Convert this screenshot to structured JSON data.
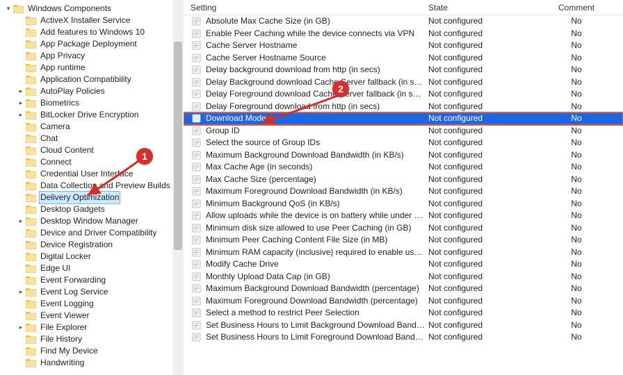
{
  "tree": {
    "root_label": "Windows Components",
    "items": [
      {
        "label": "ActiveX Installer Service"
      },
      {
        "label": "Add features to Windows 10"
      },
      {
        "label": "App Package Deployment"
      },
      {
        "label": "App Privacy"
      },
      {
        "label": "App runtime"
      },
      {
        "label": "Application Compatibility"
      },
      {
        "label": "AutoPlay Policies",
        "expandable": true
      },
      {
        "label": "Biometrics",
        "expandable": true
      },
      {
        "label": "BitLocker Drive Encryption",
        "expandable": true
      },
      {
        "label": "Camera"
      },
      {
        "label": "Chat"
      },
      {
        "label": "Cloud Content"
      },
      {
        "label": "Connect"
      },
      {
        "label": "Credential User Interface"
      },
      {
        "label": "Data Collection and Preview Builds"
      },
      {
        "label": "Delivery Optimization",
        "selected": true
      },
      {
        "label": "Desktop Gadgets"
      },
      {
        "label": "Desktop Window Manager",
        "expandable": true
      },
      {
        "label": "Device and Driver Compatibility"
      },
      {
        "label": "Device Registration"
      },
      {
        "label": "Digital Locker"
      },
      {
        "label": "Edge UI"
      },
      {
        "label": "Event Forwarding"
      },
      {
        "label": "Event Log Service",
        "expandable": true
      },
      {
        "label": "Event Logging"
      },
      {
        "label": "Event Viewer"
      },
      {
        "label": "File Explorer",
        "expandable": true
      },
      {
        "label": "File History"
      },
      {
        "label": "Find My Device"
      },
      {
        "label": "Handwriting"
      }
    ]
  },
  "list": {
    "headers": {
      "setting": "Setting",
      "state": "State",
      "comment": "Comment"
    },
    "rows": [
      {
        "setting": "Absolute Max Cache Size (in GB)",
        "state": "Not configured",
        "comment": "No"
      },
      {
        "setting": "Enable Peer Caching while the device connects via VPN",
        "state": "Not configured",
        "comment": "No"
      },
      {
        "setting": "Cache Server Hostname",
        "state": "Not configured",
        "comment": "No"
      },
      {
        "setting": "Cache Server Hostname Source",
        "state": "Not configured",
        "comment": "No"
      },
      {
        "setting": "Delay background download from http (in secs)",
        "state": "Not configured",
        "comment": "No"
      },
      {
        "setting": "Delay Background download Cache Server fallback (in seconds)",
        "state": "Not configured",
        "comment": "No"
      },
      {
        "setting": "Delay Foreground download Cache Server fallback (in seconds)",
        "state": "Not configured",
        "comment": "No"
      },
      {
        "setting": "Delay Foreground download from http (in secs)",
        "state": "Not configured",
        "comment": "No"
      },
      {
        "setting": "Download Mode",
        "state": "Not configured",
        "comment": "No",
        "selected": true
      },
      {
        "setting": "Group ID",
        "state": "Not configured",
        "comment": "No"
      },
      {
        "setting": "Select the source of Group IDs",
        "state": "Not configured",
        "comment": "No"
      },
      {
        "setting": "Maximum Background Download Bandwidth (in KB/s)",
        "state": "Not configured",
        "comment": "No"
      },
      {
        "setting": "Max Cache Age (in seconds)",
        "state": "Not configured",
        "comment": "No"
      },
      {
        "setting": "Max Cache Size (percentage)",
        "state": "Not configured",
        "comment": "No"
      },
      {
        "setting": "Maximum Foreground Download Bandwidth (in KB/s)",
        "state": "Not configured",
        "comment": "No"
      },
      {
        "setting": "Minimum Background QoS (in KB/s)",
        "state": "Not configured",
        "comment": "No"
      },
      {
        "setting": "Allow uploads while the device is on battery while under set ...",
        "state": "Not configured",
        "comment": "No"
      },
      {
        "setting": "Minimum disk size allowed to use Peer Caching (in GB)",
        "state": "Not configured",
        "comment": "No"
      },
      {
        "setting": "Minimum Peer Caching Content File Size (in MB)",
        "state": "Not configured",
        "comment": "No"
      },
      {
        "setting": "Minimum RAM capacity (inclusive) required to enable use of ...",
        "state": "Not configured",
        "comment": "No"
      },
      {
        "setting": "Modify Cache Drive",
        "state": "Not configured",
        "comment": "No"
      },
      {
        "setting": "Monthly Upload Data Cap (in GB)",
        "state": "Not configured",
        "comment": "No"
      },
      {
        "setting": "Maximum Background Download Bandwidth (percentage)",
        "state": "Not configured",
        "comment": "No"
      },
      {
        "setting": "Maximum Foreground Download Bandwidth (percentage)",
        "state": "Not configured",
        "comment": "No"
      },
      {
        "setting": "Select a method to restrict Peer Selection",
        "state": "Not configured",
        "comment": "No"
      },
      {
        "setting": "Set Business Hours to Limit Background Download Bandwidth",
        "state": "Not configured",
        "comment": "No"
      },
      {
        "setting": "Set Business Hours to Limit Foreground Download Bandwidth",
        "state": "Not configured",
        "comment": "No"
      }
    ]
  },
  "annotations": {
    "badge1": "1",
    "badge2": "2"
  }
}
